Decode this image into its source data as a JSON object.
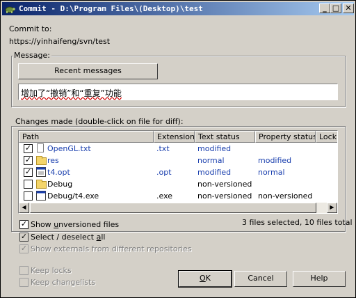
{
  "window": {
    "title": "Commit - D:\\Program Files\\(Desktop)\\test",
    "buttons": {
      "minimize": "_",
      "maximize": "□",
      "close": "✕"
    }
  },
  "commit_to": {
    "label": "Commit to:",
    "url": "https://yinhaifeng/svn/test"
  },
  "message": {
    "group_label": "Message:",
    "recent_button": "Recent messages",
    "text": "增加了“撤销”和“重复”功能"
  },
  "changes": {
    "group_label": "Changes made (double-click on file for diff):",
    "columns": [
      "Path",
      "Extension",
      "Text status",
      "Property status",
      "Lock"
    ],
    "rows": [
      {
        "checked": true,
        "icon": "file-icon",
        "path": "OpenGL.txt",
        "extension": ".txt",
        "text_status": "modified",
        "property_status": "",
        "blue": true
      },
      {
        "checked": true,
        "icon": "folder-icon",
        "path": "res",
        "extension": "",
        "text_status": "normal",
        "property_status": "modified",
        "blue": true
      },
      {
        "checked": true,
        "icon": "exe-icon",
        "path": "t4.opt",
        "extension": ".opt",
        "text_status": "modified",
        "property_status": "normal",
        "blue": true
      },
      {
        "checked": false,
        "icon": "folder-icon",
        "path": "Debug",
        "extension": "",
        "text_status": "non-versioned",
        "property_status": "",
        "blue": false
      },
      {
        "checked": false,
        "icon": "exe-icon",
        "path": "Debug/t4.exe",
        "extension": ".exe",
        "text_status": "non-versioned",
        "property_status": "non-versioned",
        "blue": false
      }
    ],
    "summary": "3 files selected, 10 files total"
  },
  "options": {
    "show_unversioned": {
      "label_pre": "Show ",
      "label_u": "u",
      "label_post": "nversioned files",
      "checked": true
    },
    "select_all": {
      "label_pre": "Select / deselect ",
      "label_u": "a",
      "label_post": "ll",
      "checked": true
    },
    "show_externals": {
      "label": "Show externals from different repositories",
      "checked": true
    },
    "keep_locks": {
      "label": "Keep locks",
      "checked": false
    },
    "keep_changelists": {
      "label": "Keep changelists",
      "checked": false
    }
  },
  "buttons": {
    "ok_u": "O",
    "ok_rest": "K",
    "cancel": "Cancel",
    "help": "Help"
  }
}
